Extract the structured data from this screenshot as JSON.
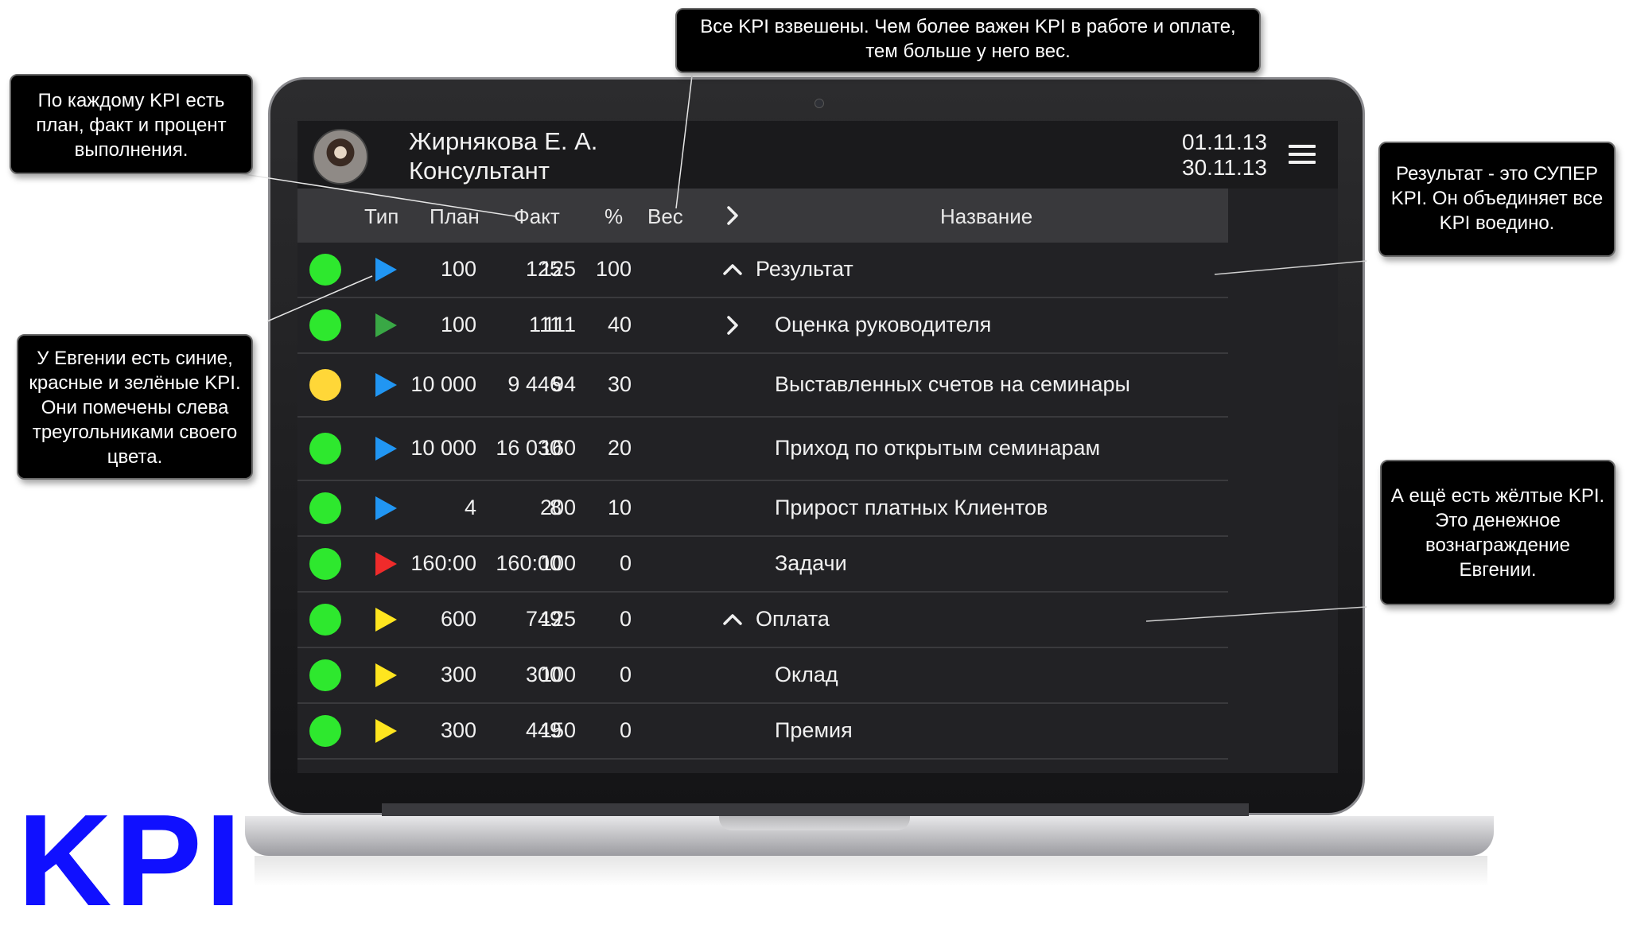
{
  "header": {
    "user_name": "Жирнякова Е. А.",
    "user_role": "Консультант",
    "date_from": "01.11.13",
    "date_to": "30.11.13"
  },
  "columns": {
    "type": "Тип",
    "plan": "План",
    "fact": "Факт",
    "percent": "%",
    "weight": "Вес",
    "name": "Название"
  },
  "rows": [
    {
      "status": "green",
      "kpi_color": "blue",
      "plan": "100",
      "fact": "125",
      "percent": "125",
      "weight": "100",
      "expand": "up",
      "name": "Результат"
    },
    {
      "status": "green",
      "kpi_color": "green",
      "plan": "100",
      "fact": "111",
      "percent": "111",
      "weight": "40",
      "expand": "right",
      "name": "Оценка руководителя"
    },
    {
      "status": "yellow",
      "kpi_color": "blue",
      "plan": "10 000",
      "fact": "9 446",
      "percent": "94",
      "weight": "30",
      "expand": "",
      "name": "Выставленных счетов на семинары"
    },
    {
      "status": "green",
      "kpi_color": "blue",
      "plan": "10 000",
      "fact": "16 030",
      "percent": "160",
      "weight": "20",
      "expand": "",
      "name": "Приход по открытым семинарам"
    },
    {
      "status": "green",
      "kpi_color": "blue",
      "plan": "4",
      "fact": "8",
      "percent": "200",
      "weight": "10",
      "expand": "",
      "name": "Прирост платных Клиентов"
    },
    {
      "status": "green",
      "kpi_color": "red",
      "plan": "160:00",
      "fact": "160:00",
      "percent": "100",
      "weight": "0",
      "expand": "",
      "name": "Задачи"
    },
    {
      "status": "green",
      "kpi_color": "yellow",
      "plan": "600",
      "fact": "749",
      "percent": "125",
      "weight": "0",
      "expand": "up",
      "name": "Оплата"
    },
    {
      "status": "green",
      "kpi_color": "yellow",
      "plan": "300",
      "fact": "300",
      "percent": "100",
      "weight": "0",
      "expand": "",
      "name": "Оклад"
    },
    {
      "status": "green",
      "kpi_color": "yellow",
      "plan": "300",
      "fact": "449",
      "percent": "150",
      "weight": "0",
      "expand": "",
      "name": "Премия"
    }
  ],
  "colors": {
    "green": "#2ee82e",
    "yellow": "#ffd738",
    "blue": "#2196f3",
    "red": "#ef2b2b",
    "tri_green": "#39a845",
    "tri_yellow": "#ffe51f"
  },
  "callouts": {
    "weights": "Все KPI взвешены. Чем более важен KPI в работе и оплате, тем больше у него вес.",
    "plan_fact": "По каждому KPI есть план, факт и процент выполнения.",
    "colors": "У Евгении есть синие, красные и зелёные KPI. Они помечены слева треугольниками своего цвета.",
    "result": "Результат - это СУПЕР KPI. Он объединяет все KPI воедино.",
    "yellow": "А ещё есть жёлтые KPI. Это денежное вознаграждение Евгении."
  },
  "logo": "KPI"
}
